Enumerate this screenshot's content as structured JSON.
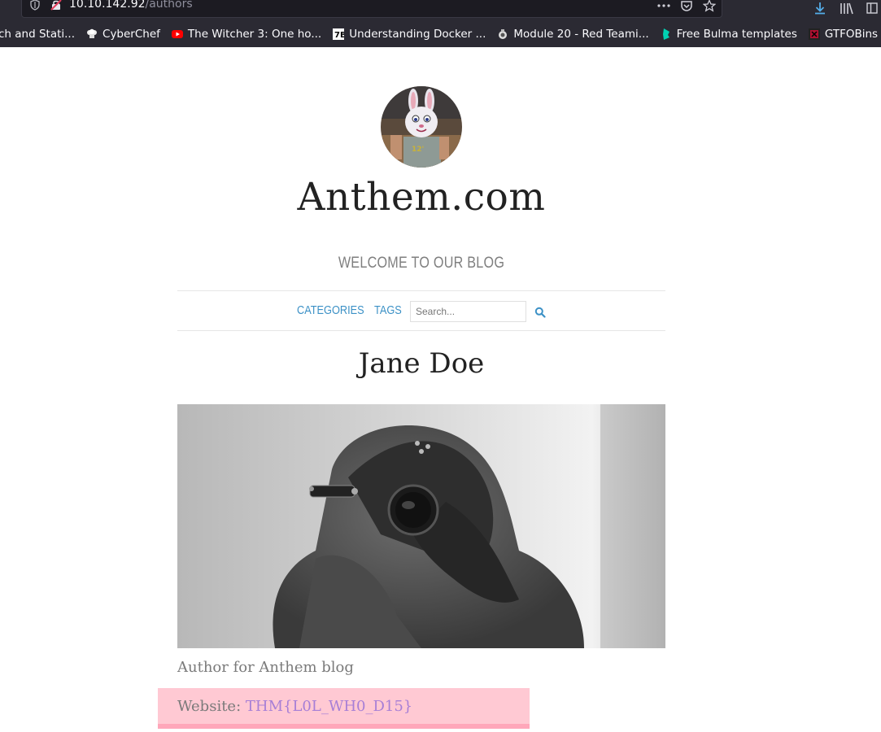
{
  "browser": {
    "url_host": "10.10.142.92",
    "url_path": "/authors",
    "bookmarks": [
      {
        "label": "ch and Stati..."
      },
      {
        "label": "CyberChef"
      },
      {
        "label": "The Witcher 3: One ho..."
      },
      {
        "label": "Understanding Docker ..."
      },
      {
        "label": "Module 20 - Red Teami..."
      },
      {
        "label": "Free Bulma templates"
      },
      {
        "label": "GTFOBins"
      }
    ]
  },
  "site": {
    "title": "Anthem.com",
    "description": "WELCOME TO OUR BLOG"
  },
  "nav": {
    "categories": "CATEGORIES",
    "tags": "TAGS",
    "search_placeholder": "Search..."
  },
  "author": {
    "name": "Jane Doe",
    "bio": "Author for Anthem blog",
    "website_label": "Website: ",
    "website_value": "THM{L0L_WH0_D15}"
  }
}
